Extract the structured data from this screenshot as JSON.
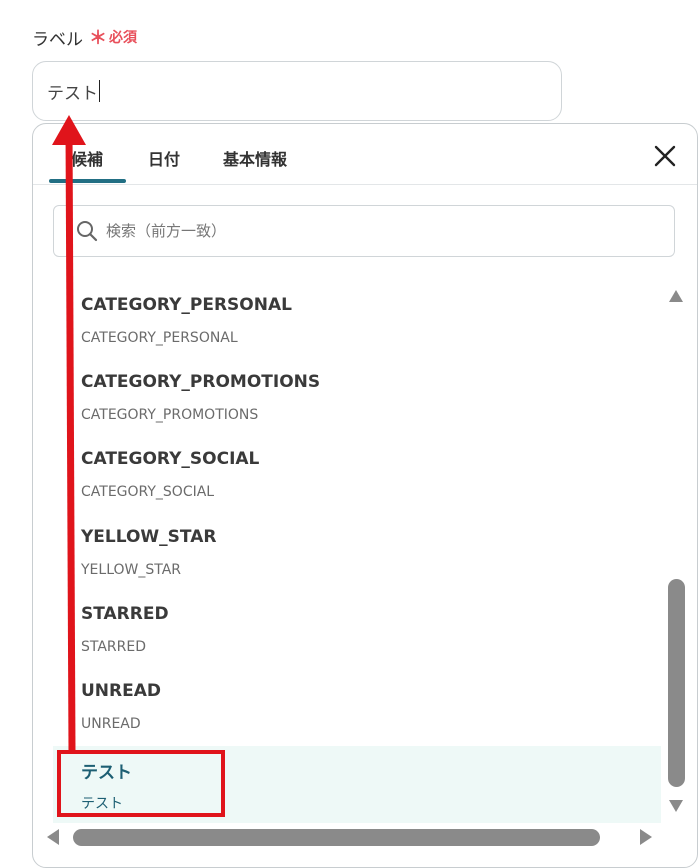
{
  "field": {
    "label": "ラベル",
    "required_star": "＊",
    "required_text": "必須",
    "input_value": "テスト"
  },
  "popup": {
    "tabs": [
      {
        "label": "候補",
        "active": true
      },
      {
        "label": "日付",
        "active": false
      },
      {
        "label": "基本情報",
        "active": false
      }
    ],
    "search": {
      "placeholder": "検索（前方一致）"
    },
    "items": [
      {
        "title": "CATEGORY_PERSONAL",
        "sub": "CATEGORY_PERSONAL"
      },
      {
        "title": "CATEGORY_PROMOTIONS",
        "sub": "CATEGORY_PROMOTIONS"
      },
      {
        "title": "CATEGORY_SOCIAL",
        "sub": "CATEGORY_SOCIAL"
      },
      {
        "title": "YELLOW_STAR",
        "sub": "YELLOW_STAR"
      },
      {
        "title": "STARRED",
        "sub": "STARRED"
      },
      {
        "title": "UNREAD",
        "sub": "UNREAD"
      },
      {
        "title": "テスト",
        "sub": "テスト",
        "selected": true
      }
    ]
  },
  "colors": {
    "accent": "#226f84",
    "required": "#e8505b",
    "annotation": "#e0141b",
    "selected_bg": "#eef9f7"
  },
  "icons": {
    "close": "close-icon",
    "search": "search-icon"
  }
}
